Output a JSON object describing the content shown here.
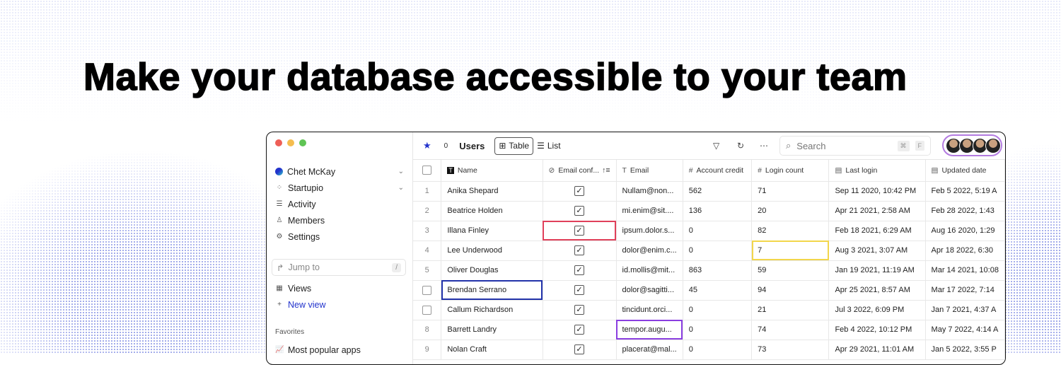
{
  "headline": "Make your database accessible to your team",
  "sidebar": {
    "user": "Chet McKay",
    "workspace": "Startupio",
    "items": [
      {
        "label": "Activity",
        "icon": "activity-icon"
      },
      {
        "label": "Members",
        "icon": "person-icon"
      },
      {
        "label": "Settings",
        "icon": "gear-icon"
      }
    ],
    "jump_placeholder": "Jump to",
    "jump_key": "/",
    "views_label": "Views",
    "new_view_label": "New view",
    "favorites_heading": "Favorites",
    "favorites": [
      "Most popular apps"
    ]
  },
  "toolbar": {
    "title": "Users",
    "count": "0",
    "table_label": "Table",
    "list_label": "List",
    "search_placeholder": "Search",
    "shortcut_cmd": "⌘",
    "shortcut_key": "F"
  },
  "colors": {
    "accent": "#2233cc",
    "red": "#e0405a",
    "yellow": "#f2d64b",
    "purple": "#8a3ee0",
    "blue": "#2233aa"
  },
  "table": {
    "columns": [
      "Name",
      "Email conf...",
      "Email",
      "Account credit",
      "Login count",
      "Last login",
      "Updated date"
    ],
    "rows": [
      {
        "n": "1",
        "name": "Anika Shepard",
        "email": "Nullam@non...",
        "credit": "562",
        "logins": "71",
        "last": "Sep 11 2020, 10:42 PM",
        "updated": "Feb 5 2022, 5:19 A"
      },
      {
        "n": "2",
        "name": "Beatrice Holden",
        "email": "mi.enim@sit....",
        "credit": "136",
        "logins": "20",
        "last": "Apr 21 2021, 2:58 AM",
        "updated": "Feb 28 2022, 1:43"
      },
      {
        "n": "3",
        "name": "Illana Finley",
        "email": "ipsum.dolor.s...",
        "credit": "0",
        "logins": "82",
        "last": "Feb 18 2021, 6:29 AM",
        "updated": "Aug 16 2020, 1:29"
      },
      {
        "n": "4",
        "name": "Lee Underwood",
        "email": "dolor@enim.c...",
        "credit": "0",
        "logins": "7",
        "last": "Aug 3 2021, 3:07 AM",
        "updated": "Apr 18 2022, 6:30"
      },
      {
        "n": "5",
        "name": "Oliver Douglas",
        "email": "id.mollis@mit...",
        "credit": "863",
        "logins": "59",
        "last": "Jan 19 2021, 11:19 AM",
        "updated": "Mar 14 2021, 10:08"
      },
      {
        "n": "",
        "name": "Brendan Serrano",
        "email": "dolor@sagitti...",
        "credit": "45",
        "logins": "94",
        "last": "Apr 25 2021, 8:57 AM",
        "updated": "Mar 17 2022, 7:14"
      },
      {
        "n": "",
        "name": "Callum Richardson",
        "email": "tincidunt.orci...",
        "credit": "0",
        "logins": "21",
        "last": "Jul 3 2022, 6:09 PM",
        "updated": "Jan 7 2021, 4:37 A"
      },
      {
        "n": "8",
        "name": "Barrett Landry",
        "email": "tempor.augu...",
        "credit": "0",
        "logins": "74",
        "last": "Feb 4 2022, 10:12 PM",
        "updated": "May 7 2022, 4:14 A"
      },
      {
        "n": "9",
        "name": "Nolan Craft",
        "email": "placerat@mal...",
        "credit": "0",
        "logins": "73",
        "last": "Apr 29 2021, 11:01 AM",
        "updated": "Jan 5 2022, 3:55 P"
      }
    ]
  }
}
